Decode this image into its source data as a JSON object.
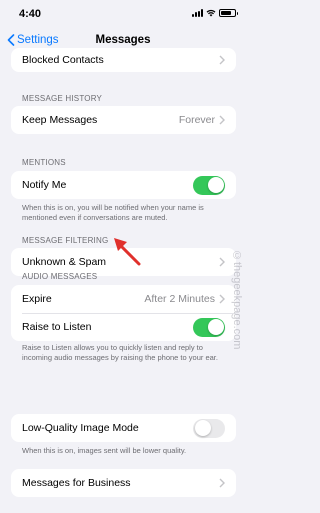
{
  "status_bar": {
    "time": "4:40",
    "battery_level": 0.75
  },
  "nav": {
    "back_label": "Settings",
    "title": "Messages"
  },
  "rows": {
    "blocked_contacts": "Blocked Contacts",
    "keep_messages": {
      "label": "Keep Messages",
      "value": "Forever"
    },
    "notify_me": {
      "label": "Notify Me",
      "on": true
    },
    "unknown_spam": "Unknown & Spam",
    "expire": {
      "label": "Expire",
      "value": "After 2 Minutes"
    },
    "raise_to_listen": {
      "label": "Raise to Listen",
      "on": true
    },
    "low_quality": {
      "label": "Low-Quality Image Mode",
      "on": false
    },
    "business": "Messages for Business"
  },
  "headers": {
    "history": "MESSAGE HISTORY",
    "mentions": "MENTIONS",
    "filtering": "MESSAGE FILTERING",
    "audio": "AUDIO MESSAGES"
  },
  "footers": {
    "notify": "When this is on, you will be notified when your name is mentioned even if conversations are muted.",
    "raise": "Raise to Listen allows you to quickly listen and reply to incoming audio messages by raising the phone to your ear.",
    "low_quality": "When this is on, images sent will be lower quality."
  },
  "watermark": "©thegeekpage.com",
  "colors": {
    "accent": "#0a7aff",
    "toggle_on": "#34c759",
    "arrow": "#e0302c"
  }
}
